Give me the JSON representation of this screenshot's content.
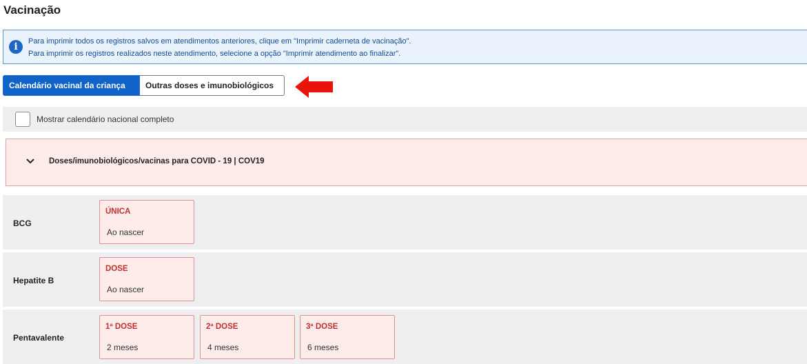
{
  "page": {
    "title": "Vacinação"
  },
  "info": {
    "line1": "Para imprimir todos os registros salvos em atendimentos anteriores, clique em \"Imprimir caderneta de vacinação\".",
    "line2": "Para imprimir os registros realizados neste atendimento, selecione a opção \"Imprimir atendimento ao finalizar\".",
    "icon": "info-icon"
  },
  "tabs": [
    {
      "label": "Calendário vacinal da criança",
      "active": true
    },
    {
      "label": "Outras doses e imunobiológicos",
      "active": false
    }
  ],
  "annotation": {
    "icon": "red-arrow-icon",
    "color": "#e8140c"
  },
  "toggle": {
    "label": "Mostrar calendário nacional completo",
    "checked": false
  },
  "covid_panel": {
    "label": "Doses/imunobiológicos/vacinas para COVID - 19 | COV19",
    "expanded": false
  },
  "vaccines": [
    {
      "name": "BCG",
      "doses": [
        {
          "title": "ÚNICA",
          "age": "Ao nascer"
        }
      ]
    },
    {
      "name": "Hepatite B",
      "doses": [
        {
          "title": "DOSE",
          "age": "Ao nascer"
        }
      ]
    },
    {
      "name": "Pentavalente",
      "doses": [
        {
          "title": "1ª DOSE",
          "age": "2 meses"
        },
        {
          "title": "2ª DOSE",
          "age": "4 meses"
        },
        {
          "title": "3ª DOSE",
          "age": "6 meses"
        }
      ]
    }
  ],
  "colors": {
    "accent": "#0f63c9",
    "dose_text": "#c62f2f",
    "dose_bg": "#fdecea"
  }
}
